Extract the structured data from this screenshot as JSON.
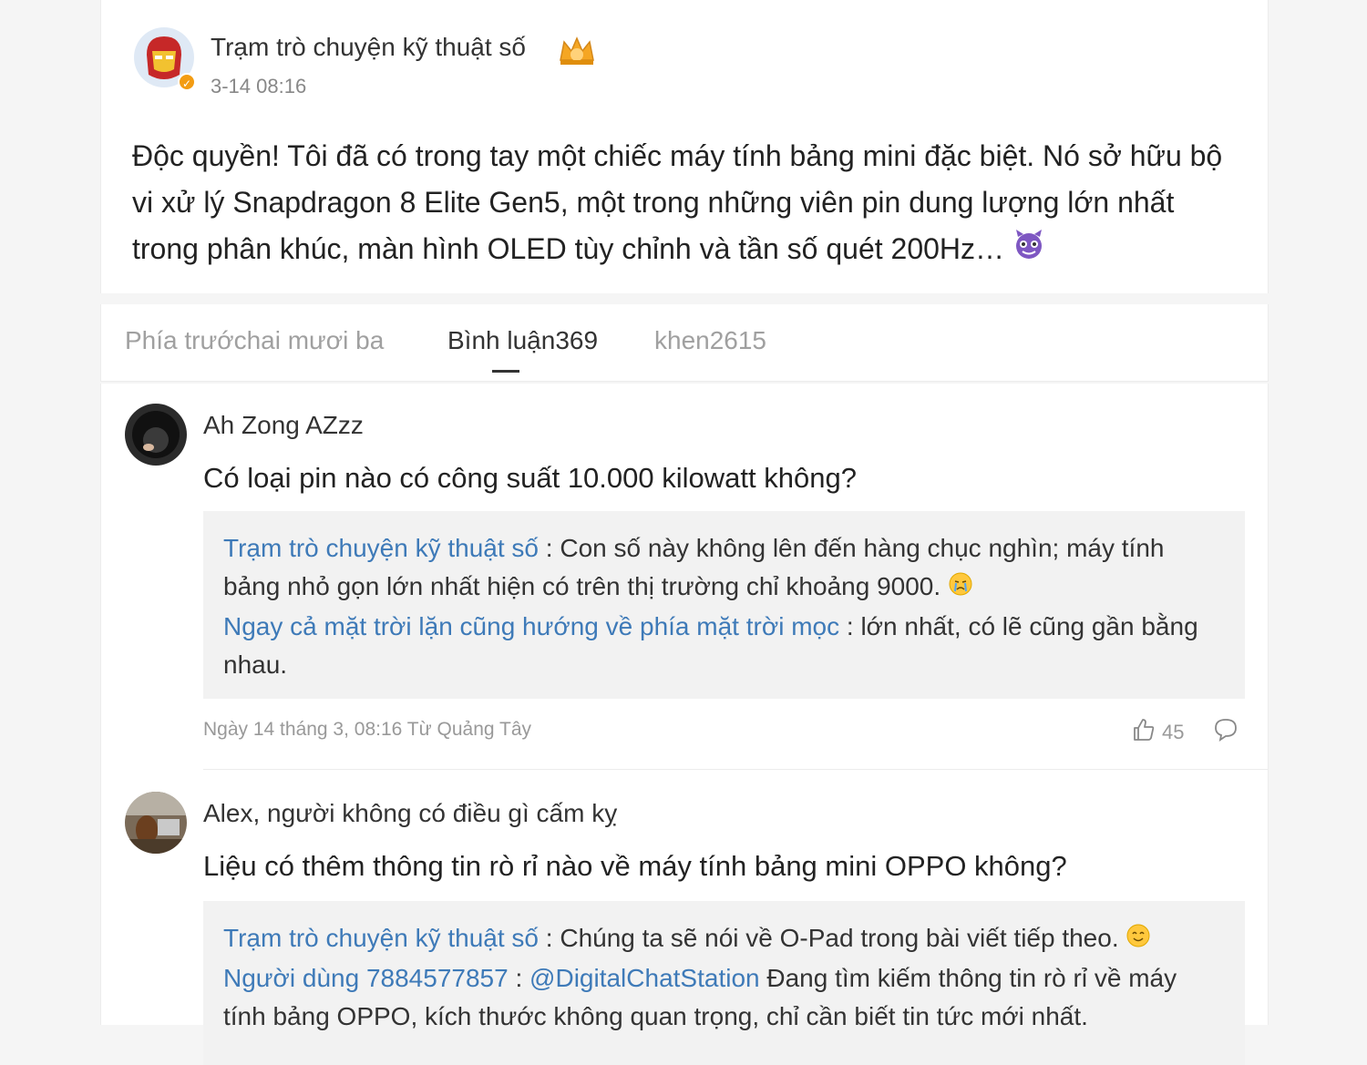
{
  "post": {
    "author": "Trạm trò chuyện kỹ thuật số",
    "time": "3-14 08:16",
    "text": "Độc quyền! Tôi đã có trong tay một chiếc máy tính bảng mini đặc biệt. Nó sở hữu bộ vi xử lý Snapdragon 8 Elite Gen5, một trong những viên pin dung lượng lớn nhất trong phân khúc, màn hình OLED tùy chỉnh và tần số quét 200Hz…"
  },
  "tabs": [
    {
      "label": "Phía trướchai mươi ba"
    },
    {
      "label": "Bình luận369"
    },
    {
      "label": "khen2615"
    }
  ],
  "comments": [
    {
      "user": "Ah Zong AZzz",
      "text": "Có loại pin nào có công suất 10.000 kilowatt không?",
      "replies": [
        {
          "user": "Trạm trò chuyện kỹ thuật số",
          "sep": " : ",
          "text": "Con số này không lên đến hàng chục nghìn; máy tính bảng nhỏ gọn lớn nhất hiện có trên thị trường chỉ khoảng 9000."
        },
        {
          "user": "Ngay cả mặt trời lặn cũng hướng về phía mặt trời mọc",
          "sep": " : ",
          "text": "lớn nhất, có lẽ cũng gần bằng nhau."
        }
      ],
      "meta": "Ngày 14 tháng 3, 08:16 Từ Quảng Tây",
      "likes": "45"
    },
    {
      "user": "Alex, người không có điều gì cấm kỵ",
      "text": "Liệu có thêm thông tin rò rỉ nào về máy tính bảng mini OPPO không?",
      "replies": [
        {
          "user": "Trạm trò chuyện kỹ thuật số",
          "sep": " : ",
          "text": "Chúng ta sẽ nói về O-Pad trong bài viết tiếp theo."
        },
        {
          "user": "Người dùng 7884577857",
          "sep": " : ",
          "mention": "@DigitalChatStation",
          "text": " Đang tìm kiếm thông tin rò rỉ về máy tính bảng OPPO, kích thước không quan trọng, chỉ cần biết tin tức mới nhất."
        }
      ]
    }
  ],
  "icons": {
    "verified": "verified-badge-icon",
    "crown": "crown-icon",
    "devil": "devil-emoji-icon",
    "crying": "crying-emoji-icon",
    "smile": "smile-emoji-icon",
    "like": "thumbs-up-icon",
    "reply": "comment-bubble-icon"
  },
  "colors": {
    "link": "#3e7ab8",
    "reply_bg": "#f2f2f2",
    "badge": "#f39c12"
  }
}
